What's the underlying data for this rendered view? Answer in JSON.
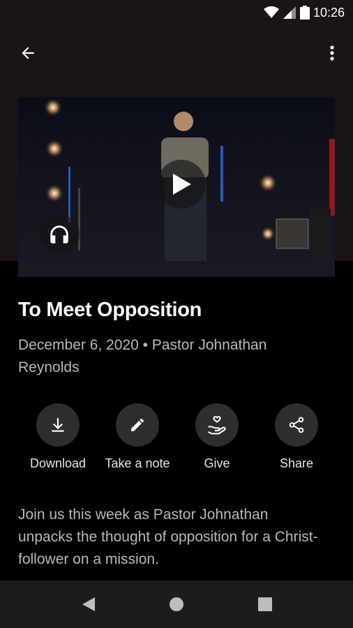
{
  "status_bar": {
    "time": "10:26"
  },
  "episode": {
    "title": "To Meet Opposition",
    "meta": "December 6, 2020 • Pastor Johnathan Reynolds",
    "description": "Join us this week as Pastor Johnathan unpacks the thought of opposition for a Christ-follower on a mission."
  },
  "actions": [
    {
      "label": "Download",
      "icon": "download-icon"
    },
    {
      "label": "Take a note",
      "icon": "pencil-icon"
    },
    {
      "label": "Give",
      "icon": "give-icon"
    },
    {
      "label": "Share",
      "icon": "share-icon"
    }
  ],
  "colors": {
    "background": "#000000",
    "header_band": "#1a1414",
    "button_circle": "#2e2e2e",
    "secondary_text": "#b8b8b8"
  }
}
